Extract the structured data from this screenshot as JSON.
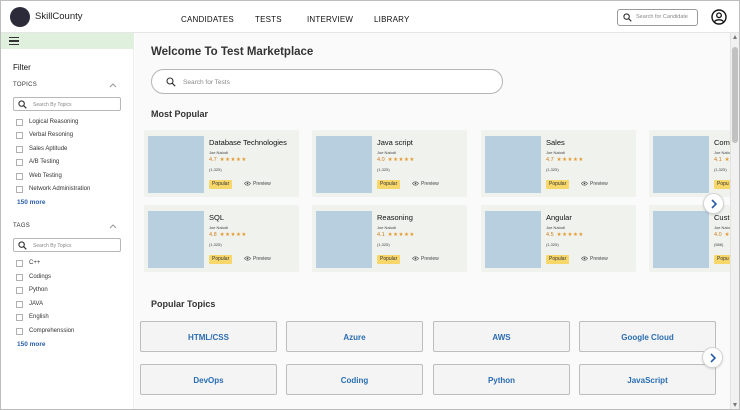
{
  "header": {
    "brand": "SkillCounty",
    "nav": [
      "CANDIDATES",
      "TESTS",
      "INTERVIEW",
      "LIBRARY"
    ],
    "search_placeholder": "Search for Candidate"
  },
  "sidebar": {
    "filter_title": "Filter",
    "topics": {
      "label": "TOPICS",
      "search_placeholder": "Search By Topics",
      "items": [
        "Logical Reasoning",
        "Verbal Resoning",
        "Sales Aptitude",
        "A/B Testing",
        "Web Testing",
        "Network Administration"
      ],
      "more": "150 more"
    },
    "tags": {
      "label": "TAGS",
      "search_placeholder": "Search By Topics",
      "items": [
        "C++",
        "Codings",
        "Python",
        "JAVA",
        "English",
        "Comprehenssion"
      ],
      "more": "150 more"
    }
  },
  "main": {
    "welcome": "Welcome To Test Marketplace",
    "search_placeholder": "Search for Tests",
    "most_popular": "Most Popular",
    "popular_topics": "Popular Topics",
    "cards": [
      {
        "title": "Database Technologies",
        "author": "Joe Nalodi",
        "rating": "4.7",
        "stars": "★★★★★",
        "count": "(1,325)",
        "badge": "Popular",
        "preview": "Preview"
      },
      {
        "title": "Java script",
        "author": "Joe Nalodi",
        "rating": "4.0",
        "stars": "★★★★★",
        "count": "(1,325)",
        "badge": "Popular",
        "preview": "Preview"
      },
      {
        "title": "Sales",
        "author": "Joe Nalodi",
        "rating": "4.7",
        "stars": "★★★★★",
        "count": "(1,325)",
        "badge": "Popular",
        "preview": "Preview"
      },
      {
        "title": "Com",
        "author": "Joe Nalo",
        "rating": "4.1",
        "stars": "★★★★",
        "count": "(1,325)",
        "badge": "Popu",
        "preview": ""
      },
      {
        "title": "SQL",
        "author": "Joe Nalodi",
        "rating": "4.8",
        "stars": "★★★★★",
        "count": "(1,325)",
        "badge": "Popular",
        "preview": "Preview"
      },
      {
        "title": "Reasoning",
        "author": "Joe Nalodi",
        "rating": "4.1",
        "stars": "★★★★★",
        "count": "(1,325)",
        "badge": "Popular",
        "preview": "Preview"
      },
      {
        "title": "Angular",
        "author": "Joe Nalodi",
        "rating": "4.5",
        "stars": "★★★★★",
        "count": "(1,325)",
        "badge": "Popular",
        "preview": "Preview"
      },
      {
        "title": "Cust",
        "author": "Joe Nalo",
        "rating": "4.0",
        "stars": "★★★★",
        "count": "(586)",
        "badge": "Popu",
        "preview": ""
      }
    ],
    "topics": [
      "HTML/CSS",
      "Azure",
      "AWS",
      "Google Cloud",
      "DevOps",
      "Coding",
      "Python",
      "JavaScript"
    ]
  }
}
